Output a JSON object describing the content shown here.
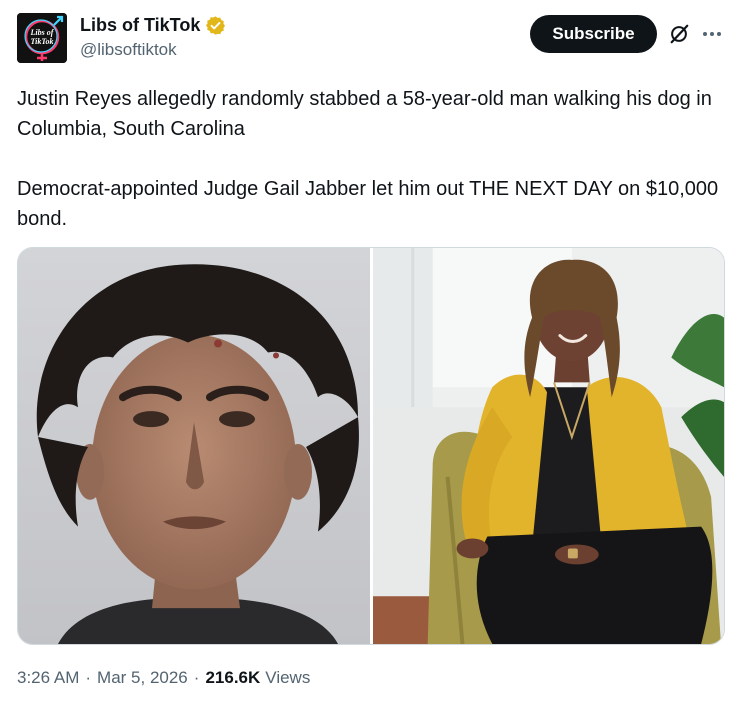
{
  "author": {
    "display_name": "Libs of TikTok",
    "handle": "@libsoftiktok",
    "avatar_icon": "libs-of-tiktok-logo",
    "avatar_text": "Libs of TikTok",
    "verified_color": "#e2b719"
  },
  "actions": {
    "subscribe_label": "Subscribe",
    "grok_icon": "grok-icon",
    "more_icon": "more-icon"
  },
  "tweet": {
    "paragraph_1": "Justin Reyes allegedly randomly stabbed a 58-year-old man walking his dog in Columbia, South Carolina",
    "paragraph_2": "Democrat-appointed Judge Gail Jabber let him out THE NEXT DAY on $10,000 bond."
  },
  "media": {
    "left_image": "mugshot-photo",
    "right_image": "judge-photo"
  },
  "meta": {
    "time": "3:26 AM",
    "date": "Mar 5, 2026",
    "views_count": "216.6K",
    "views_label": "Views",
    "separator": "·"
  }
}
